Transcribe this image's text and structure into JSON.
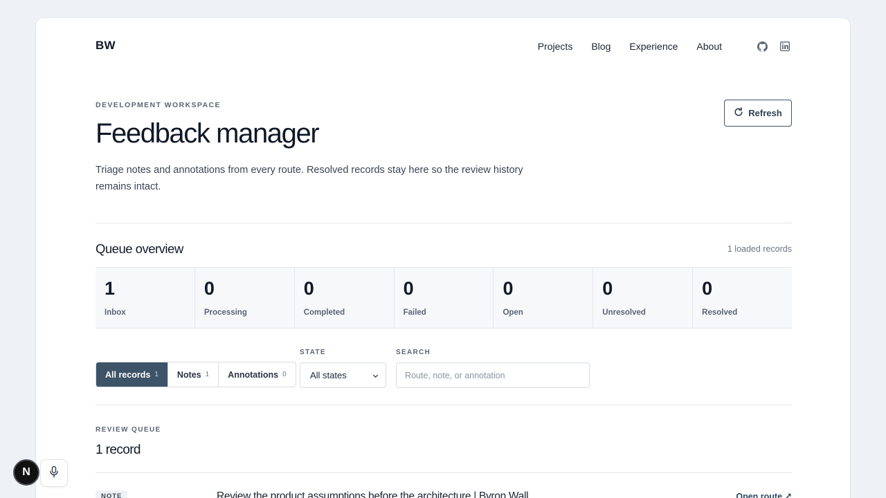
{
  "header": {
    "brand": "BW",
    "nav": [
      "Projects",
      "Blog",
      "Experience",
      "About"
    ],
    "icons": [
      "github-icon",
      "linkedin-icon"
    ]
  },
  "hero": {
    "eyebrow": "DEVELOPMENT WORKSPACE",
    "title": "Feedback manager",
    "description": "Triage notes and annotations from every route. Resolved records stay here so the review history remains intact.",
    "refresh_label": "Refresh"
  },
  "overview": {
    "title": "Queue overview",
    "loaded": "1 loaded records",
    "stats": [
      {
        "value": "1",
        "label": "Inbox"
      },
      {
        "value": "0",
        "label": "Processing"
      },
      {
        "value": "0",
        "label": "Completed"
      },
      {
        "value": "0",
        "label": "Failed"
      },
      {
        "value": "0",
        "label": "Open"
      },
      {
        "value": "0",
        "label": "Unresolved"
      },
      {
        "value": "0",
        "label": "Resolved"
      }
    ]
  },
  "filters": {
    "tabs": [
      {
        "label": "All records",
        "count": "1",
        "active": true
      },
      {
        "label": "Notes",
        "count": "1",
        "active": false
      },
      {
        "label": "Annotations",
        "count": "0",
        "active": false
      }
    ],
    "state_label": "STATE",
    "state_value": "All states",
    "search_label": "SEARCH",
    "search_placeholder": "Route, note, or annotation"
  },
  "queue": {
    "eyebrow": "REVIEW QUEUE",
    "count": "1 record",
    "rows": [
      {
        "badge": "NOTE",
        "title": "Review the product assumptions before the architecture | Byron Wall",
        "link": "Open route ↗"
      }
    ]
  },
  "floating": {
    "badge": "N"
  },
  "colors": {
    "accent": "#3d5368",
    "background": "#eef1f5"
  }
}
